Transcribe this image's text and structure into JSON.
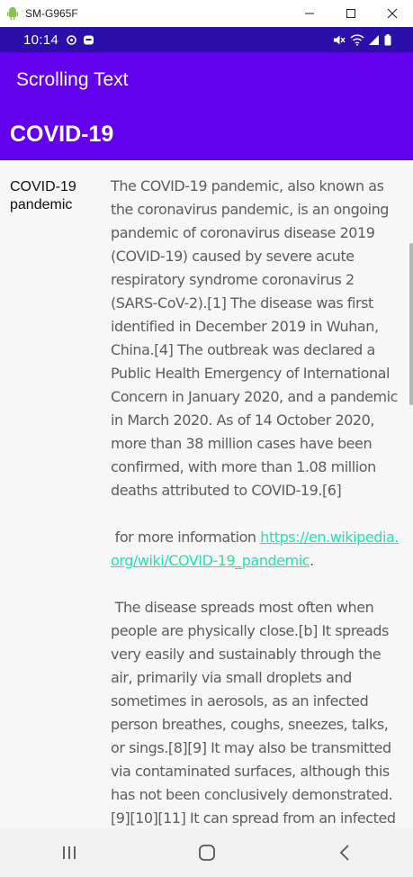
{
  "window": {
    "title": "SM-G965F",
    "app_icon": "android-icon",
    "controls": [
      "minimize-icon",
      "maximize-icon",
      "close-icon"
    ]
  },
  "status_bar": {
    "time": "10:14",
    "left_icons": [
      "sync-icon",
      "notification-icon"
    ],
    "right_icons": [
      "mute-icon",
      "wifi-icon",
      "signal-icon",
      "battery-icon"
    ],
    "background": "#2a0fa8"
  },
  "app_bar": {
    "title": "Scrolling Text",
    "background": "#6200ee"
  },
  "section": {
    "title": "COVID-19"
  },
  "content": {
    "side_label": "COVID-19 pandemic",
    "paragraph1": "The COVID-19 pandemic, also known as the coronavirus pandemic, is an ongoing pandemic of coronavirus disease 2019 (COVID-19) caused by severe acute respiratory syndrome coronavirus 2 (SARS-CoV-2).[1] The disease was first identified in December 2019 in Wuhan, China.[4] The outbreak was declared a Public Health Emergency of International Concern in January 2020, and a pandemic in March 2020. As of 14 October 2020, more than 38 million cases have been confirmed, with more than 1.08 million deaths attributed to COVID-19.[6]",
    "info_prefix": "for more information",
    "info_link": "https://en.wikipedia.org/wiki/COVID-19_pandemic",
    "info_suffix": ".",
    "paragraph2": "The disease spreads most often when people are physically close.[b] It spreads very easily and sustainably through the air, primarily via small droplets and sometimes in aerosols, as an infected person breathes, coughs, sneezes, talks, or sings.[8][9] It may also be transmitted via contaminated surfaces, although this has not been conclusively demonstrated.[9][10][11] It can spread from an infected",
    "link_color": "#20e3b2"
  },
  "nav_bar": {
    "buttons": [
      "recent-apps-icon",
      "home-icon",
      "back-icon"
    ]
  }
}
